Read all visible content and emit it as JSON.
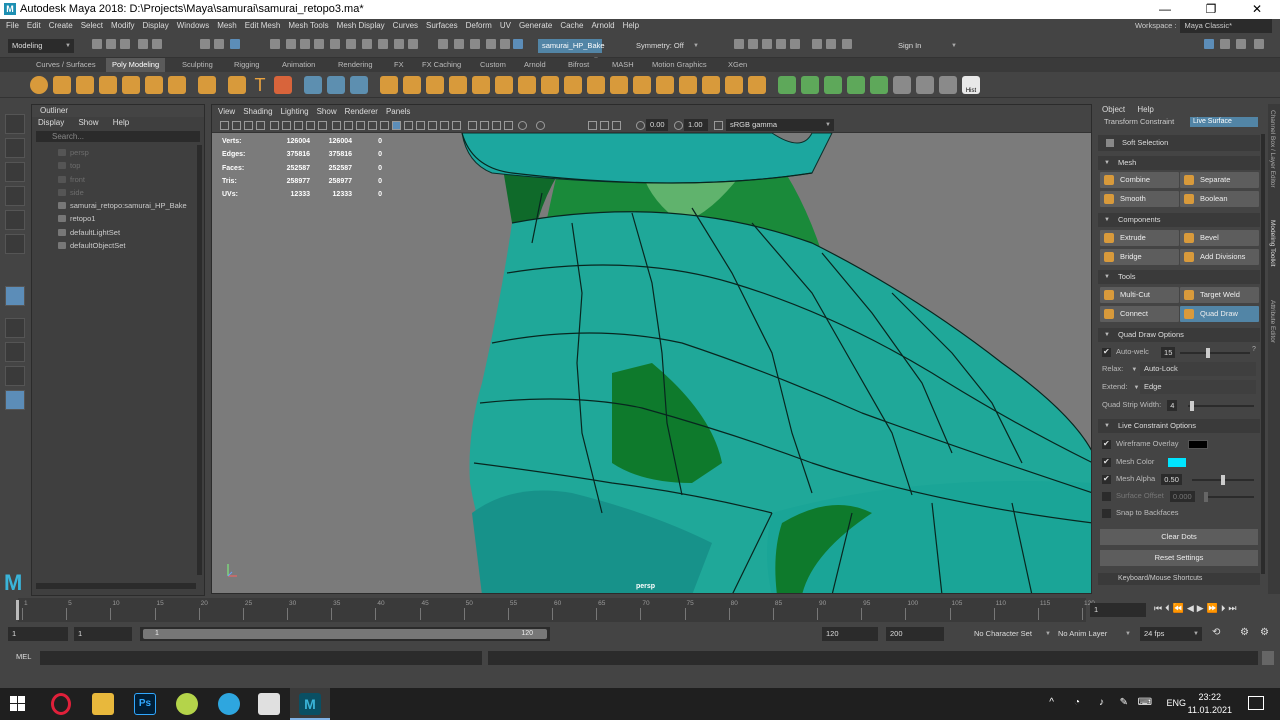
{
  "window": {
    "title": "Autodesk Maya 2018: D:\\Projects\\Maya\\samurai\\samurai_retopo3.ma*",
    "logo": "M"
  },
  "menubar": [
    "File",
    "Edit",
    "Create",
    "Select",
    "Modify",
    "Display",
    "Windows",
    "Mesh",
    "Edit Mesh",
    "Mesh Tools",
    "Mesh Display",
    "Curves",
    "Surfaces",
    "Deform",
    "UV",
    "Generate",
    "Cache",
    "Arnold",
    "Help"
  ],
  "workspace": {
    "label": "Workspace :",
    "value": "Maya Classic*"
  },
  "statusline": {
    "mode": "Modeling",
    "live_object": "samurai_HP_Bake",
    "symmetry": "Symmetry: Off",
    "signin": "Sign In"
  },
  "shelf_tabs": [
    "Curves / Surfaces",
    "Poly Modeling",
    "Sculpting",
    "Rigging",
    "Animation",
    "Rendering",
    "FX",
    "FX Caching",
    "Custom",
    "Arnold",
    "Bifrost",
    "MASH",
    "Motion Graphics",
    "XGen"
  ],
  "shelf_active": "Poly Modeling",
  "shelf_hist": "Hist",
  "outliner": {
    "title": "Outliner",
    "menu": [
      "Display",
      "Show",
      "Help"
    ],
    "search_placeholder": "Search...",
    "items": [
      {
        "label": "persp",
        "dim": true
      },
      {
        "label": "top",
        "dim": true
      },
      {
        "label": "front",
        "dim": true
      },
      {
        "label": "side",
        "dim": true
      },
      {
        "label": "samurai_retopo:samurai_HP_Bake",
        "dim": false
      },
      {
        "label": "retopo1",
        "dim": false
      },
      {
        "label": "defaultLightSet",
        "dim": false
      },
      {
        "label": "defaultObjectSet",
        "dim": false
      }
    ]
  },
  "viewport": {
    "menu": [
      "View",
      "Shading",
      "Lighting",
      "Show",
      "Renderer",
      "Panels"
    ],
    "exposure": "0.00",
    "gamma": "1.00",
    "colorspace": "sRGB gamma",
    "camera": "persp",
    "hud": [
      {
        "label": "Verts:",
        "a": "126004",
        "b": "126004",
        "c": "0"
      },
      {
        "label": "Edges:",
        "a": "375816",
        "b": "375816",
        "c": "0"
      },
      {
        "label": "Faces:",
        "a": "252587",
        "b": "252587",
        "c": "0"
      },
      {
        "label": "Tris:",
        "a": "258977",
        "b": "258977",
        "c": "0"
      },
      {
        "label": "UVs:",
        "a": "12333",
        "b": "12333",
        "c": "0"
      }
    ]
  },
  "modeling_toolkit": {
    "menu": [
      "Object",
      "Help"
    ],
    "transform_constraint": "Transform Constraint",
    "constraint_value": "Live Surface",
    "soft_selection": "Soft Selection",
    "sections": {
      "mesh": "Mesh",
      "components": "Components",
      "tools": "Tools",
      "quad_draw_options": "Quad Draw Options",
      "live_constraint_options": "Live Constraint Options"
    },
    "mesh_buttons": [
      "Combine",
      "Separate",
      "Smooth",
      "Boolean"
    ],
    "component_buttons": [
      "Extrude",
      "Bevel",
      "Bridge",
      "Add Divisions"
    ],
    "tool_buttons": [
      "Multi-Cut",
      "Target Weld",
      "Connect",
      "Quad Draw"
    ],
    "active_tool": "Quad Draw",
    "quad_draw": {
      "auto_weld_label": "Auto-welc",
      "auto_weld_value": "15",
      "relax_label": "Relax:",
      "relax_value": "Auto-Lock",
      "extend_label": "Extend:",
      "extend_value": "Edge",
      "strip_label": "Quad Strip Width:",
      "strip_value": "4"
    },
    "live_constraint": {
      "wireframe_overlay": "Wireframe Overlay",
      "wireframe_color": "#000000",
      "mesh_color_label": "Mesh Color",
      "mesh_color": "#00e5ff",
      "mesh_alpha_label": "Mesh Alpha",
      "mesh_alpha": "0.50",
      "surface_offset_label": "Surface Offset",
      "surface_offset": "0.000",
      "snap_backfaces": "Snap to Backfaces"
    },
    "clear_dots": "Clear Dots",
    "reset_settings": "Reset Settings",
    "shortcuts": "Keyboard/Mouse Shortcuts"
  },
  "side_tabs": [
    "Channel Box / Layer Editor",
    "Modeling Toolkit",
    "Attribute Editor"
  ],
  "timeline": {
    "ticks": [
      "1",
      "5",
      "10",
      "15",
      "20",
      "25",
      "30",
      "35",
      "40",
      "45",
      "50",
      "55",
      "60",
      "65",
      "70",
      "75",
      "80",
      "85",
      "90",
      "95",
      "100",
      "105",
      "110",
      "115",
      "120"
    ],
    "current_frame": "1"
  },
  "range": {
    "start": "1",
    "playback_start": "1",
    "slider_start": "1",
    "slider_end": "120",
    "playback_end": "120",
    "end": "200",
    "character_set": "No Character Set",
    "anim_layer": "No Anim Layer",
    "fps": "24 fps"
  },
  "command_line": {
    "label": "MEL"
  },
  "taskbar": {
    "language": "ENG",
    "time": "23:22",
    "date": "11.01.2021",
    "apps": [
      "windows-start",
      "opera",
      "file-explorer",
      "photoshop",
      "tennis-app",
      "telegram",
      "zbrush",
      "maya"
    ]
  }
}
